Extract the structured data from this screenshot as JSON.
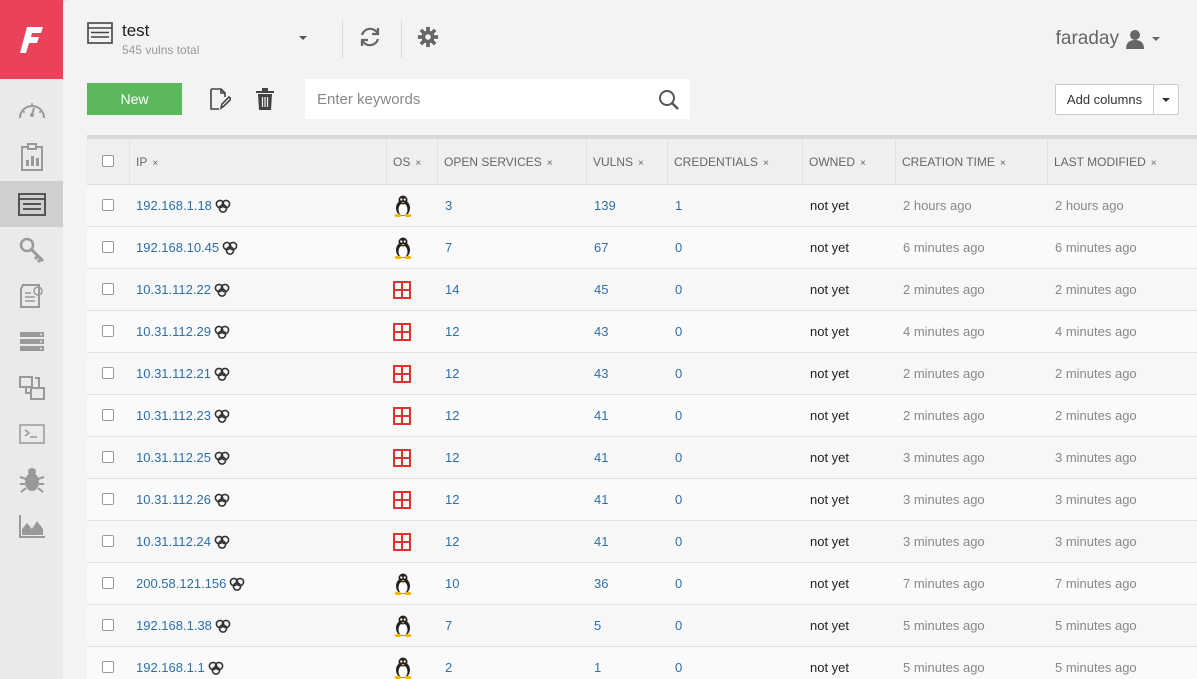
{
  "workspace": {
    "name": "test",
    "vulns_total": "545 vulns total"
  },
  "user": {
    "name": "faraday"
  },
  "toolbar": {
    "new_label": "New",
    "search_placeholder": "Enter keywords",
    "add_columns_label": "Add columns"
  },
  "sidebar": {
    "items": [
      {
        "icon": "dashboard-gauge-icon"
      },
      {
        "icon": "reports-clipboard-icon"
      },
      {
        "icon": "hosts-list-icon",
        "active": true
      },
      {
        "icon": "credentials-key-icon"
      },
      {
        "icon": "executive-report-icon"
      },
      {
        "icon": "servers-icon"
      },
      {
        "icon": "workspaces-icon"
      },
      {
        "icon": "console-icon"
      },
      {
        "icon": "bug-icon"
      },
      {
        "icon": "analytics-chart-icon"
      }
    ]
  },
  "colors": {
    "brand": "#e9425a",
    "new_button": "#5cb85c",
    "link": "#2f6fa8",
    "windows_os": "#e03030"
  },
  "table": {
    "headers": {
      "ip": "IP",
      "os": "OS",
      "open_services": "OPEN SERVICES",
      "vulns": "VULNS",
      "credentials": "CREDENTIALS",
      "owned": "OWNED",
      "creation_time": "CREATION TIME",
      "last_modified": "LAST MODIFIED"
    },
    "remove_glyph": "×",
    "rows": [
      {
        "ip": "192.168.1.18",
        "os": "linux",
        "open_services": "3",
        "vulns": "139",
        "credentials": "1",
        "owned": "not yet",
        "creation_time": "2 hours ago",
        "last_modified": "2 hours ago"
      },
      {
        "ip": "192.168.10.45",
        "os": "linux",
        "open_services": "7",
        "vulns": "67",
        "credentials": "0",
        "owned": "not yet",
        "creation_time": "6 minutes ago",
        "last_modified": "6 minutes ago"
      },
      {
        "ip": "10.31.112.22",
        "os": "windows",
        "open_services": "14",
        "vulns": "45",
        "credentials": "0",
        "owned": "not yet",
        "creation_time": "2 minutes ago",
        "last_modified": "2 minutes ago"
      },
      {
        "ip": "10.31.112.29",
        "os": "windows",
        "open_services": "12",
        "vulns": "43",
        "credentials": "0",
        "owned": "not yet",
        "creation_time": "4 minutes ago",
        "last_modified": "4 minutes ago"
      },
      {
        "ip": "10.31.112.21",
        "os": "windows",
        "open_services": "12",
        "vulns": "43",
        "credentials": "0",
        "owned": "not yet",
        "creation_time": "2 minutes ago",
        "last_modified": "2 minutes ago"
      },
      {
        "ip": "10.31.112.23",
        "os": "windows",
        "open_services": "12",
        "vulns": "41",
        "credentials": "0",
        "owned": "not yet",
        "creation_time": "2 minutes ago",
        "last_modified": "2 minutes ago"
      },
      {
        "ip": "10.31.112.25",
        "os": "windows",
        "open_services": "12",
        "vulns": "41",
        "credentials": "0",
        "owned": "not yet",
        "creation_time": "3 minutes ago",
        "last_modified": "3 minutes ago"
      },
      {
        "ip": "10.31.112.26",
        "os": "windows",
        "open_services": "12",
        "vulns": "41",
        "credentials": "0",
        "owned": "not yet",
        "creation_time": "3 minutes ago",
        "last_modified": "3 minutes ago"
      },
      {
        "ip": "10.31.112.24",
        "os": "windows",
        "open_services": "12",
        "vulns": "41",
        "credentials": "0",
        "owned": "not yet",
        "creation_time": "3 minutes ago",
        "last_modified": "3 minutes ago"
      },
      {
        "ip": "200.58.121.156",
        "os": "linux",
        "open_services": "10",
        "vulns": "36",
        "credentials": "0",
        "owned": "not yet",
        "creation_time": "7 minutes ago",
        "last_modified": "7 minutes ago"
      },
      {
        "ip": "192.168.1.38",
        "os": "linux",
        "open_services": "7",
        "vulns": "5",
        "credentials": "0",
        "owned": "not yet",
        "creation_time": "5 minutes ago",
        "last_modified": "5 minutes ago"
      },
      {
        "ip": "192.168.1.1",
        "os": "linux",
        "open_services": "2",
        "vulns": "1",
        "credentials": "0",
        "owned": "not yet",
        "creation_time": "5 minutes ago",
        "last_modified": "5 minutes ago"
      }
    ]
  }
}
